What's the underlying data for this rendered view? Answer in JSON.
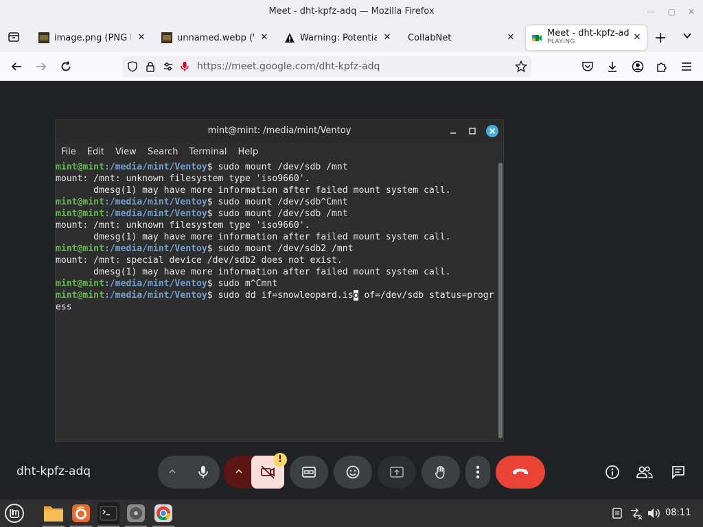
{
  "window": {
    "title": "Meet - dht-kpfz-adq — Mozilla Firefox"
  },
  "tabs": [
    {
      "label": "image.png (PNG Ima",
      "icon": "image-thumbnail-icon",
      "close": "✕"
    },
    {
      "label": "unnamed.webp (WE",
      "icon": "image-thumbnail-icon",
      "close": "✕"
    },
    {
      "label": "Warning: Potential S",
      "icon": "warning-icon",
      "close": "✕"
    },
    {
      "label": "CollabNet",
      "icon": "",
      "close": "✕"
    },
    {
      "label": "Meet - dht-kpfz-adq",
      "sub": "PLAYING",
      "icon": "google-meet-icon",
      "close": "✕"
    }
  ],
  "navbar": {
    "url": "https://meet.google.com/dht-kpfz-adq"
  },
  "terminal": {
    "title": "mint@mint: /media/mint/Ventoy",
    "menu": [
      "File",
      "Edit",
      "View",
      "Search",
      "Terminal",
      "Help"
    ],
    "prompt_user": "mint@mint",
    "prompt_path": ":/media/mint/Ventoy",
    "lines": [
      {
        "type": "cmd",
        "text": "$ sudo mount /dev/sdb /mnt"
      },
      {
        "type": "out",
        "text": "mount: /mnt: unknown filesystem type 'iso9660'."
      },
      {
        "type": "out",
        "text": "       dmesg(1) may have more information after failed mount system call."
      },
      {
        "type": "cmd",
        "text": "$ sudo mount /dev/sdb^Cmnt"
      },
      {
        "type": "cmd",
        "text": "$ sudo mount /dev/sdb /mnt"
      },
      {
        "type": "out",
        "text": "mount: /mnt: unknown filesystem type 'iso9660'."
      },
      {
        "type": "out",
        "text": "       dmesg(1) may have more information after failed mount system call."
      },
      {
        "type": "cmd",
        "text": "$ sudo mount /dev/sdb2 /mnt"
      },
      {
        "type": "out",
        "text": "mount: /mnt: special device /dev/sdb2 does not exist."
      },
      {
        "type": "out",
        "text": "       dmesg(1) may have more information after failed mount system call."
      },
      {
        "type": "cmd",
        "text": "$ sudo m^Cmnt"
      }
    ],
    "last_cmd_before_cursor": "$ sudo dd if=snowleopard.is",
    "cursor_char": "o",
    "last_cmd_after_cursor": " of=/dev/sdb status=progr",
    "wrap_line": "ess"
  },
  "meet": {
    "meeting_code": "dht-kpfz-adq",
    "camera_warning_badge": "!",
    "end_call_color": "#ea4335",
    "camera_off_color": "#f9dedc"
  },
  "taskbar": {
    "clock": "08:11"
  }
}
